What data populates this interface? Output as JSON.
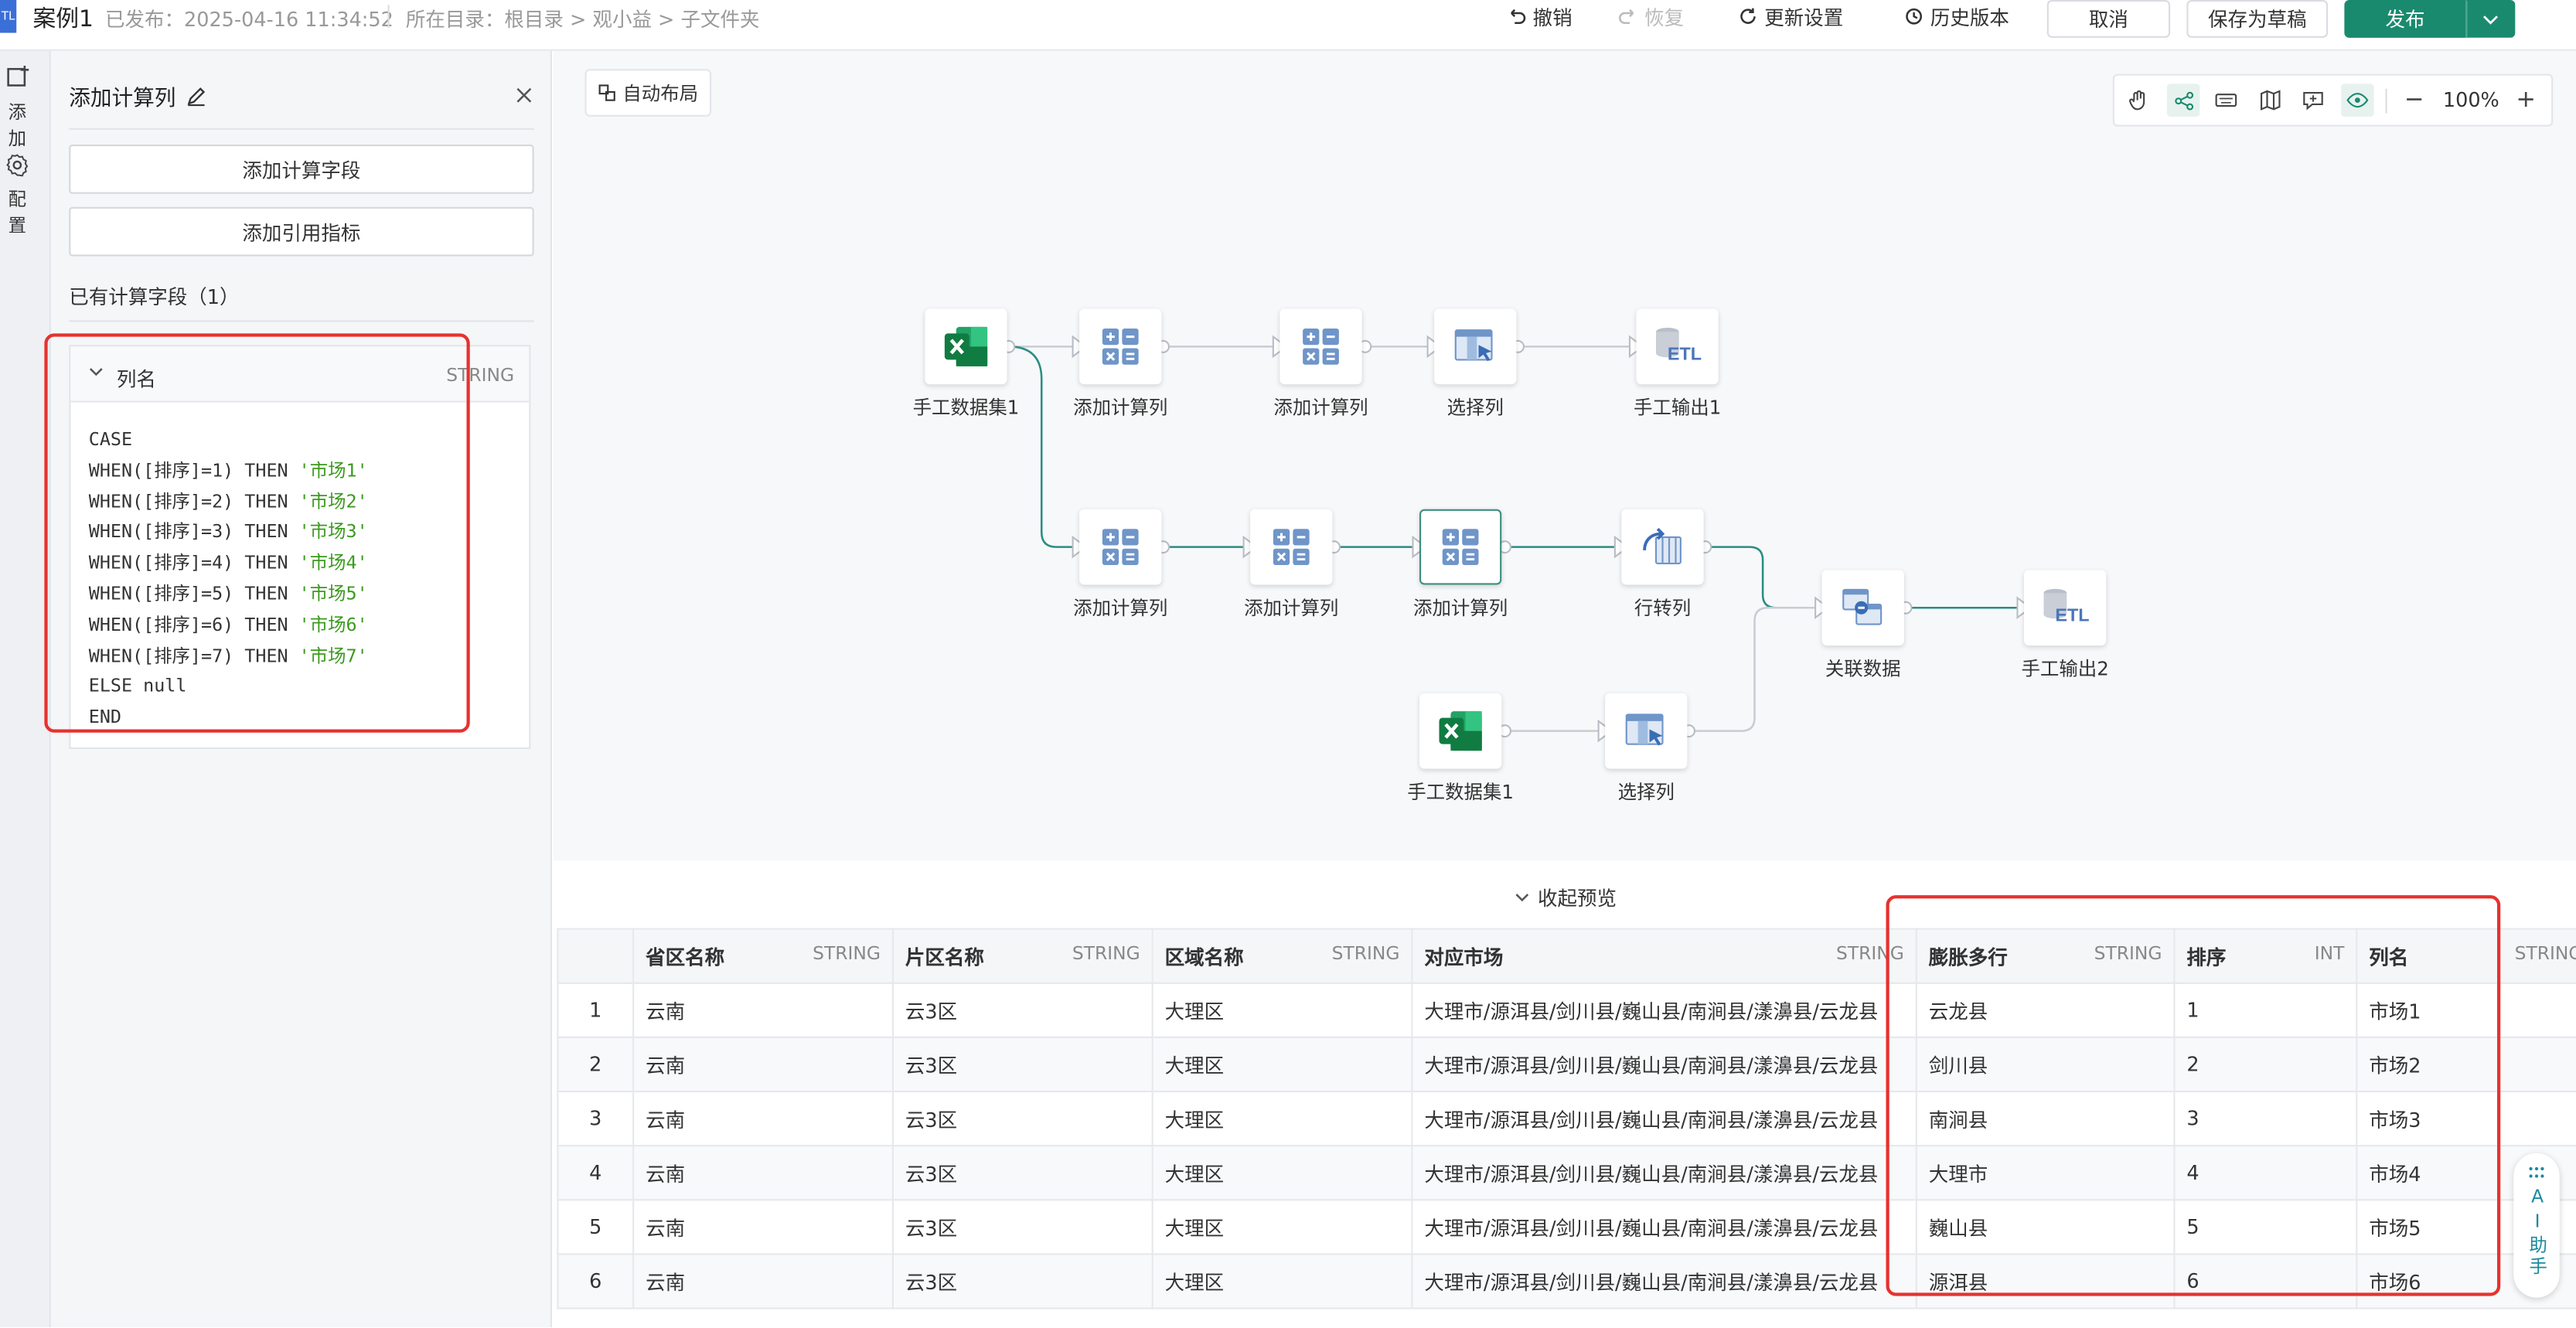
{
  "topbar": {
    "app_badge": "TL",
    "title": "案例1",
    "published": "已发布：2025-04-16 11:34:52",
    "directory": "所在目录：根目录 > 观小益 > 子文件夹",
    "undo": "撤销",
    "redo": "恢复",
    "update_settings": "更新设置",
    "history": "历史版本",
    "cancel": "取消",
    "save_draft": "保存为草稿",
    "publish": "发布"
  },
  "leftbar": {
    "add": "添加",
    "config": "配置"
  },
  "panel": {
    "title": "添加计算列",
    "add_field": "添加计算字段",
    "add_metric": "添加引用指标",
    "existing": "已有计算字段（1）",
    "field_name": "列名",
    "field_type": "STRING",
    "code_lines": [
      {
        "code": "CASE",
        "str": ""
      },
      {
        "code": "WHEN([排序]=1) THEN ",
        "str": "'市场1'"
      },
      {
        "code": "WHEN([排序]=2) THEN ",
        "str": "'市场2'"
      },
      {
        "code": "WHEN([排序]=3) THEN ",
        "str": "'市场3'"
      },
      {
        "code": "WHEN([排序]=4) THEN ",
        "str": "'市场4'"
      },
      {
        "code": "WHEN([排序]=5) THEN ",
        "str": "'市场5'"
      },
      {
        "code": "WHEN([排序]=6) THEN ",
        "str": "'市场6'"
      },
      {
        "code": "WHEN([排序]=7) THEN ",
        "str": "'市场7'"
      },
      {
        "code": "ELSE null",
        "str": ""
      },
      {
        "code": "END",
        "str": ""
      }
    ]
  },
  "canvas": {
    "auto_layout": "自动布局",
    "zoom": "100%",
    "nodes": [
      {
        "label": "手工数据集1",
        "icon": "excel-icon"
      },
      {
        "label": "添加计算列",
        "icon": "calc-icon"
      },
      {
        "label": "添加计算列",
        "icon": "calc-icon"
      },
      {
        "label": "选择列",
        "icon": "select-column-icon"
      },
      {
        "label": "手工输出1",
        "icon": "etl-output-icon"
      },
      {
        "label": "添加计算列",
        "icon": "calc-icon"
      },
      {
        "label": "添加计算列",
        "icon": "calc-icon"
      },
      {
        "label": "添加计算列",
        "icon": "calc-icon"
      },
      {
        "label": "行转列",
        "icon": "pivot-icon"
      },
      {
        "label": "关联数据",
        "icon": "join-icon"
      },
      {
        "label": "手工输出2",
        "icon": "etl-output-icon"
      },
      {
        "label": "手工数据集1",
        "icon": "excel-icon"
      },
      {
        "label": "选择列",
        "icon": "select-column-icon"
      }
    ]
  },
  "preview": {
    "collapse": "收起预览",
    "columns": [
      {
        "name": "省区名称",
        "type": "STRING"
      },
      {
        "name": "片区名称",
        "type": "STRING"
      },
      {
        "name": "区域名称",
        "type": "STRING"
      },
      {
        "name": "对应市场",
        "type": "STRING"
      },
      {
        "name": "膨胀多行",
        "type": "STRING"
      },
      {
        "name": "排序",
        "type": "INT"
      },
      {
        "name": "列名",
        "type": "STRING"
      }
    ],
    "rows": [
      [
        "1",
        "云南",
        "云3区",
        "大理区",
        "大理市/源洱县/剑川县/巍山县/南涧县/漾濞县/云龙县",
        "云龙县",
        "1",
        "市场1"
      ],
      [
        "2",
        "云南",
        "云3区",
        "大理区",
        "大理市/源洱县/剑川县/巍山县/南涧县/漾濞县/云龙县",
        "剑川县",
        "2",
        "市场2"
      ],
      [
        "3",
        "云南",
        "云3区",
        "大理区",
        "大理市/源洱县/剑川县/巍山县/南涧县/漾濞县/云龙县",
        "南涧县",
        "3",
        "市场3"
      ],
      [
        "4",
        "云南",
        "云3区",
        "大理区",
        "大理市/源洱县/剑川县/巍山县/南涧县/漾濞县/云龙县",
        "大理市",
        "4",
        "市场4"
      ],
      [
        "5",
        "云南",
        "云3区",
        "大理区",
        "大理市/源洱县/剑川县/巍山县/南涧县/漾濞县/云龙县",
        "巍山县",
        "5",
        "市场5"
      ],
      [
        "6",
        "云南",
        "云3区",
        "大理区",
        "大理市/源洱县/剑川县/巍山县/南涧县/漾濞县/云龙县",
        "源洱县",
        "6",
        "市场6"
      ]
    ]
  },
  "ai": {
    "label": "AI助手"
  },
  "colors": {
    "brand": "#1a8a6e",
    "highlight": "#e6322e",
    "string": "#3c9a1f"
  }
}
